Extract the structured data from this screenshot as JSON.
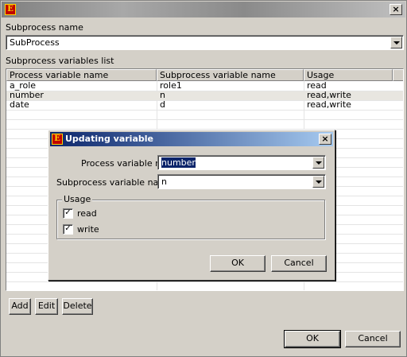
{
  "window": {
    "icon_text": "E",
    "close_label": "×"
  },
  "main": {
    "subprocess_label": "Subprocess name",
    "subprocess_value": "SubProcess",
    "vars_label": "Subprocess variables list",
    "table": {
      "columns": [
        "Process variable name",
        "Subprocess variable name",
        "Usage"
      ],
      "rows": [
        [
          "a_role",
          "role1",
          "read"
        ],
        [
          "number",
          "n",
          "read,write"
        ],
        [
          "date",
          "d",
          "read,write"
        ]
      ],
      "selected_row": 1
    },
    "add_label": "Add",
    "edit_label": "Edit",
    "delete_label": "Delete",
    "ok_label": "OK",
    "cancel_label": "Cancel"
  },
  "dialog": {
    "title": "Updating variable",
    "icon_text": "E",
    "close_label": "×",
    "process_var_label": "Process variable name:",
    "process_var_value": "number",
    "subprocess_var_label": "Subprocess variable name:",
    "subprocess_var_value": "n",
    "usage_label": "Usage",
    "read_label": "read",
    "read_checked": true,
    "write_label": "write",
    "write_checked": true,
    "check_mark": "✓",
    "ok_label": "OK",
    "cancel_label": "Cancel"
  },
  "colors": {
    "title_active": "#0a246a",
    "selection": "#0a246a",
    "face": "#d4d0c8"
  }
}
